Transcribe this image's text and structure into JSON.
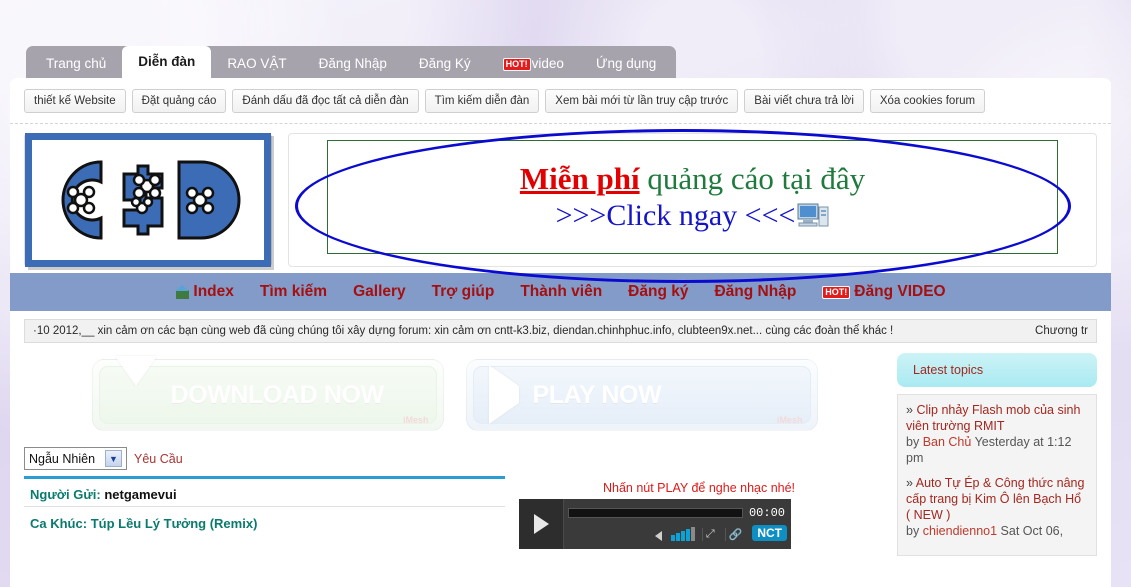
{
  "browser_tabs": [
    {
      "label": "Trang chủ",
      "active": false
    },
    {
      "label": "Diễn đàn",
      "active": true
    },
    {
      "label": "RAO VẬT",
      "active": false
    },
    {
      "label": "Đăng Nhập",
      "active": false
    },
    {
      "label": "Đăng Ký",
      "active": false
    },
    {
      "label": "video",
      "badge": "HOT!",
      "active": false
    },
    {
      "label": "Ứng dụng",
      "active": false
    }
  ],
  "toolbar_buttons": [
    "thiết kế Website",
    "Đặt quảng cáo",
    "Đánh dấu đã đọc tất cả diễn đàn",
    "Tìm kiếm diễn đàn",
    "Xem bài mới từ lần truy cập trước",
    "Bài viết chưa trả lời",
    "Xóa cookies forum"
  ],
  "logo": {
    "text": "C$D",
    "color": "#3b6cb5"
  },
  "banner": {
    "line1_red": "Miễn phí",
    "line1_green": " quảng cáo tại đây",
    "line2": ">>>Click ngay <<<",
    "icon": "computer-icon",
    "red": "#e20000",
    "green": "#1f7a3d",
    "blue": "#1414c8",
    "ellipse": "#0a0ad0"
  },
  "nav": {
    "bg": "#839bc8",
    "link_color": "#a50f0f",
    "items": [
      {
        "label": "Index",
        "icon": "home-icon"
      },
      {
        "label": "Tìm kiếm"
      },
      {
        "label": "Gallery"
      },
      {
        "label": "Trợ giúp"
      },
      {
        "label": "Thành viên"
      },
      {
        "label": "Đăng ký"
      },
      {
        "label": "Đăng Nhập"
      },
      {
        "label": "Đăng VIDEO",
        "badge": "HOT!"
      }
    ]
  },
  "marquee": {
    "text": "·10 2012,__ xin cảm ơn các bạn cùng web đã cùng chúng tôi xây dựng forum: xin cảm ơn cntt-k3.biz, diendan.chinhphuc.info, clubteen9x.net... cùng các đoàn thể khác !",
    "tail": "Chương tr"
  },
  "ads": {
    "download": {
      "label": "DOWNLOAD NOW",
      "glyph": "download-triangle-icon",
      "brand": "iMesh"
    },
    "play": {
      "label": "PLAY NOW",
      "glyph": "play-triangle-icon",
      "brand": "iMesh"
    }
  },
  "music": {
    "mode_selected": "Ngẫu Nhiên",
    "request_link": "Yêu Cầu",
    "sender_label": "Người Gửi:",
    "sender_value": "netgamevui",
    "song_label": "Ca Khúc:",
    "song_value": "Túp Lều Lý Tưởng (Remix)"
  },
  "player": {
    "hint": "Nhấn nút PLAY để nghe nhạc nhé!",
    "time": "00:00",
    "brand": "NCT",
    "play_icon": "play-icon",
    "volume_icon": "speaker-icon",
    "fullscreen_icon": "expand-icon",
    "link_icon": "link-icon"
  },
  "sidebar": {
    "title": "Latest topics",
    "topics": [
      {
        "bullet": "»",
        "title": "Clip nhảy Flash mob của sinh viên trường RMIT",
        "by_label": "by",
        "author": "Ban Chủ",
        "when": "Yesterday at 1:12 pm"
      },
      {
        "bullet": "»",
        "title": "Auto Tự Ép & Công thức nâng cấp trang bị Kim Ô lên Bạch Hổ ( NEW )",
        "by_label": "by",
        "author": "chiendienno1",
        "when": "Sat Oct 06,"
      }
    ]
  }
}
